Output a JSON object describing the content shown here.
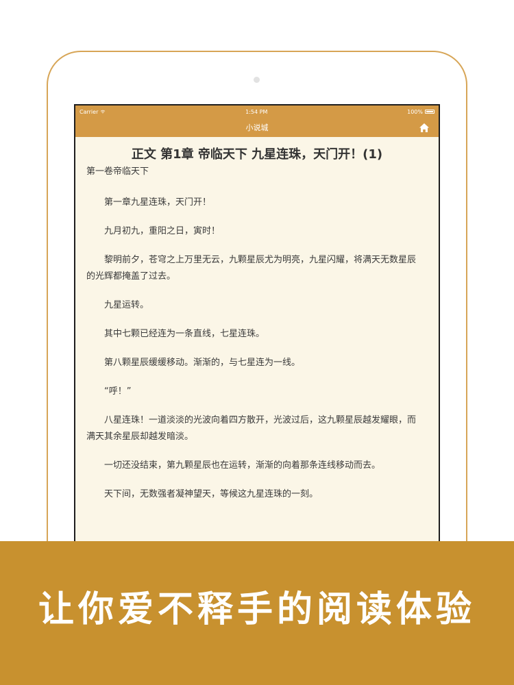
{
  "status_bar": {
    "carrier": "Carrier",
    "time": "1:54 PM",
    "battery": "100%"
  },
  "nav": {
    "title": "小说城",
    "home_icon": "home-icon"
  },
  "content": {
    "chapter_title": "正文 第1章 帝临天下 九星连珠，天门开！(1)",
    "volume_title": "第一卷帝临天下",
    "paragraphs": [
      "第一章九星连珠，天门开！",
      "九月初九，重阳之日，寅时！",
      "黎明前夕，苍穹之上万里无云，九颗星辰尤为明亮，九星闪耀，将满天无数星辰的光辉都掩盖了过去。",
      "九星运转。",
      "其中七颗已经连为一条直线，七星连珠。",
      "第八颗星辰缓缓移动。渐渐的，与七星连为一线。",
      "“呼！”",
      "八星连珠！一道淡淡的光波向着四方散开，光波过后，这九颗星辰越发耀眼，而满天其余星辰却越发暗淡。",
      "一切还没结束，第九颗星辰也在运转，渐渐的向着那条连线移动而去。",
      "天下间，无数强者凝神望天，等候这九星连珠的一刻。"
    ]
  },
  "banner": {
    "text": "让你爱不释手的阅读体验"
  },
  "colors": {
    "accent": "#d49a46",
    "banner": "#c8912f",
    "paper": "#fbf6e7"
  }
}
